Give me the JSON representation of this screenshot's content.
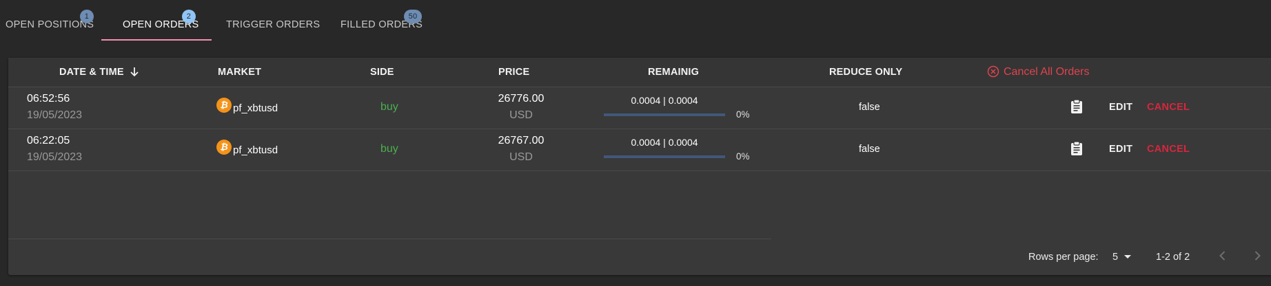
{
  "tabs": [
    {
      "label": "OPEN POSITIONS",
      "badge": "1"
    },
    {
      "label": "OPEN ORDERS",
      "badge": "2"
    },
    {
      "label": "TRIGGER ORDERS",
      "badge": ""
    },
    {
      "label": "FILLED ORDERS",
      "badge": "50"
    }
  ],
  "active_tab": "OPEN ORDERS",
  "table": {
    "columns": [
      "DATE & TIME",
      "MARKET",
      "SIDE",
      "PRICE",
      "REMAINIG",
      "REDUCE ONLY"
    ],
    "cancel_all_label": "Cancel All Orders",
    "rows": [
      {
        "time": "06:52:56",
        "date": "19/05/2023",
        "market": "pf_xbtusd",
        "coin_symbol": "₿",
        "side": "buy",
        "price": "26776.00",
        "currency": "USD",
        "remaining": "0.0004 | 0.0004",
        "remaining_pct": "0%",
        "remaining_fill": 0,
        "reduce_only": "false",
        "edit_label": "EDIT",
        "cancel_label": "CANCEL"
      },
      {
        "time": "06:22:05",
        "date": "19/05/2023",
        "market": "pf_xbtusd",
        "coin_symbol": "₿",
        "side": "buy",
        "price": "26767.00",
        "currency": "USD",
        "remaining": "0.0004 | 0.0004",
        "remaining_pct": "0%",
        "remaining_fill": 0,
        "reduce_only": "false",
        "edit_label": "EDIT",
        "cancel_label": "CANCEL"
      }
    ]
  },
  "pagination": {
    "rows_per_page_label": "Rows per page:",
    "rows_per_page_value": "5",
    "range": "1-2 of 2"
  },
  "colors": {
    "background": "#282828",
    "panel": "#393939",
    "accent_tab": "#f48fb1",
    "buy": "#4caf50",
    "cancel": "#d7263d",
    "coin": "#f4931a"
  }
}
